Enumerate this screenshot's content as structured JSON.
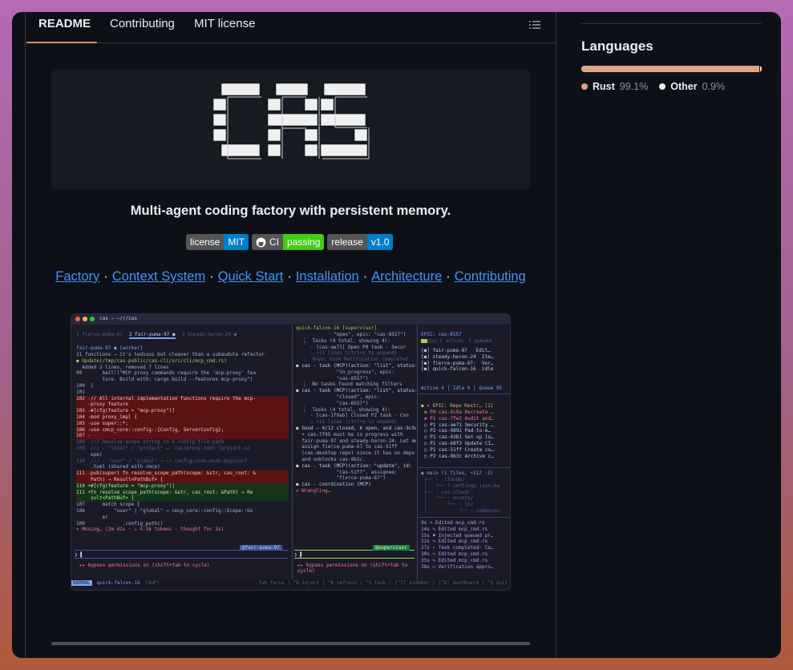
{
  "tabs": [
    {
      "label": "README",
      "active": true
    },
    {
      "label": "Contributing",
      "active": false
    },
    {
      "label": "MIT license",
      "active": false
    }
  ],
  "tagline": "Multi-agent coding factory with persistent memory.",
  "badges": [
    {
      "key": "license",
      "value": "MIT",
      "color": "#007ec6"
    },
    {
      "key": "CI",
      "value": "passing",
      "color": "#4c1",
      "icon": "github-icon"
    },
    {
      "key": "release",
      "value": "v1.0",
      "color": "#007ec6"
    }
  ],
  "nav_links": [
    "Factory",
    "Context System",
    "Quick Start",
    "Installation",
    "Architecture",
    "Contributing"
  ],
  "languages": {
    "title": "Languages",
    "items": [
      {
        "name": "Rust",
        "percent": "99.1%",
        "share": 0.991,
        "color": "#dea584"
      },
      {
        "name": "Other",
        "percent": "0.9%",
        "share": 0.009,
        "color": "#ededed"
      }
    ]
  },
  "terminal": {
    "title": "cas — ~/r/cas",
    "tabs": [
      "1 fierce-puma-67",
      "2 fair-puma-97 ●",
      "3 steady-heron-24 ●"
    ],
    "worker_header": "fair-puma-97 ● [worker]",
    "worker_lines": [
      "11 functions — it's tedious but cleaner than a subaudule refactor.",
      "● Update(/tmp/cas-public/cas-cli/src/cli/mcp_cmd.rs)",
      "  Added 2 lines, removed 7 lines",
      "99       bail!(\"MCP proxy commands require the 'mcp-proxy' fea",
      "         ture. Build with: cargo build --features mcp-proxy\")",
      "100  }",
      "101",
      "102 -// All internal implementation functions require the mcp-",
      "    -proxy feature",
      "103 -#[cfg(feature = \"mcp-proxy\")]",
      "104 -mod proxy_impl {",
      "105 -use super::*;",
      "106 -use cmcp_core::config::{Config, ServerConfig};",
      "107 -",
      "108  /// Resolve scope string to a config file path.",
      "109  /// - \"local\" / \"project\" → .cas/proxy.toml (project-sc",
      "     ope)",
      "110  /// - \"user\" / \"global\" → ~/.config/code-mode-mcp/conf",
      "     .toml (shared with cmcp)",
      "111 -pub(super) fn resolve_scope_path(scope: &str, cas_root: &",
      "     Path) → Result<PathBuf> {",
      "110 +#[cfg(feature = \"mcp-proxy\")]",
      "111 +fn resolve_scope_path(scope: &str, cas_root: &Path) → Re",
      "     sult<PathBuf> {",
      "107      match scope {",
      "108          \"user\" | \"global\" ⇒ cmcp_core::config::Scope::Us",
      "         er",
      "109             .config_path()",
      "✶ Musing… (2m 41s · ↓ 4.5k tokens · thought for 2s)"
    ],
    "worker_tag": "@fair-puma-97",
    "bypass": "▸▸ bypass permissions on (shift+tab to cycle)",
    "sup_header": "quick-falcon-16 [supervisor]",
    "sup_lines": [
      "             \"open\", epic: \"cas-8557\")",
      "  ⎿  Tasks (4 total, showing 4):",
      "",
      "     · [cas-ae71] Open P0 task · Secur",
      "     … +11 lines (ctrl+o to expand)",
      "  ⎿  Async hook Notification completed",
      "",
      "● cas - task (MCP)(action: \"list\", status:",
      "              \"in_progress\", epic:",
      "              \"cas-8557\")",
      "  ⎿  No tasks found matching filters",
      "",
      "● cas - task (MCP)(action: \"list\", status:",
      "              \"closed\", epic:",
      "              \"cas-8557\")",
      "  ⎿  Tasks (4 total, showing 4):",
      "",
      "     · [cas-1f9ab] Closed P2 task · Con",
      "     … +11 lines (ctrl+o to expand)",
      "",
      "● Good — 4/12 closed, 6 open, and cas-9c9a",
      "  + cas-7f95 must be in progress with",
      "  fair-puma-97 and steady-heron-24. Let me",
      "  assign fierce-puma-67 to cas-51ff",
      "  (cas-desktop repo) since it has no deps",
      "  and unblocks cas-9b3c.",
      "",
      "● cas - task (MCP)(action: \"update\", id:",
      "              \"cas-51ff\", assignee:",
      "              \"fierce-puma-67\")",
      "",
      "● cas - coordination (MCP)",
      "",
      "✶ Wrangling…"
    ],
    "sup_tag": "@supervisor",
    "epic_title": "EPIC: cas-8557",
    "epic_progress": "1 active, 5 queued",
    "agents": [
      "[●] fair-puma-97   Edit…",
      "[●] steady-heron-24  Ite…",
      "[●] fierce-puma-67:  Ver…",
      "[●] quick-falcon-16  idle"
    ],
    "status_counts": "Active 4 │ Idle 0 │ Queue 95",
    "epic2_title": "● ▾ EPIC: Repo Restr… [1]",
    "epic2_tasks": [
      "✱ P0 cas-9c9a Recreate …",
      "✱ P1 cas-7fe5 Audit and…",
      "○ P1 cas-ae71 Security …",
      "○ P2 cas-9892 Pad-to-m…",
      "○ P1 cas-03b1 Set up lo…",
      "○ P1 cas-b8f3 Update CI…",
      "○ P1 cas-51ff Create co…",
      "○ P2 cas-9b3c Archive c…"
    ],
    "branch_title": "◉ main (1 files, +117 -2)",
    "tree_lines": [
      "├── ◦ .claude/",
      "│   └── ? settings.json.ba",
      "├── ◦ cas-cloud/",
      "│   └── ◦ assets/",
      "│       └── ◦ js/",
      "│           └── ◦ componen"
    ],
    "events": [
      "9s ✎ Edited mcp_cmd.rs",
      "14s ✎ Edited mcp_cmd.rs",
      "15s ⚑ Injected queued pr…",
      "22s ✎ Edited mcp_cmd.rs",
      "27s ✓ Task completed: Ca…",
      "30s ✎ Edited mcp_cmd.rs",
      "35s ✎ Edited mcp_cmd.rs",
      "38s ☐ Verification appro…"
    ],
    "footer_mode": "NORMAL",
    "footer_agent": "quick-falcon-16",
    "footer_sup": "[SUP]",
    "footer_keys": "Tab focus │ ^N inject │ ^R refresh │ ^S task │ [^T] sidebar │ [^D] dashboard │ ^Q quit"
  }
}
